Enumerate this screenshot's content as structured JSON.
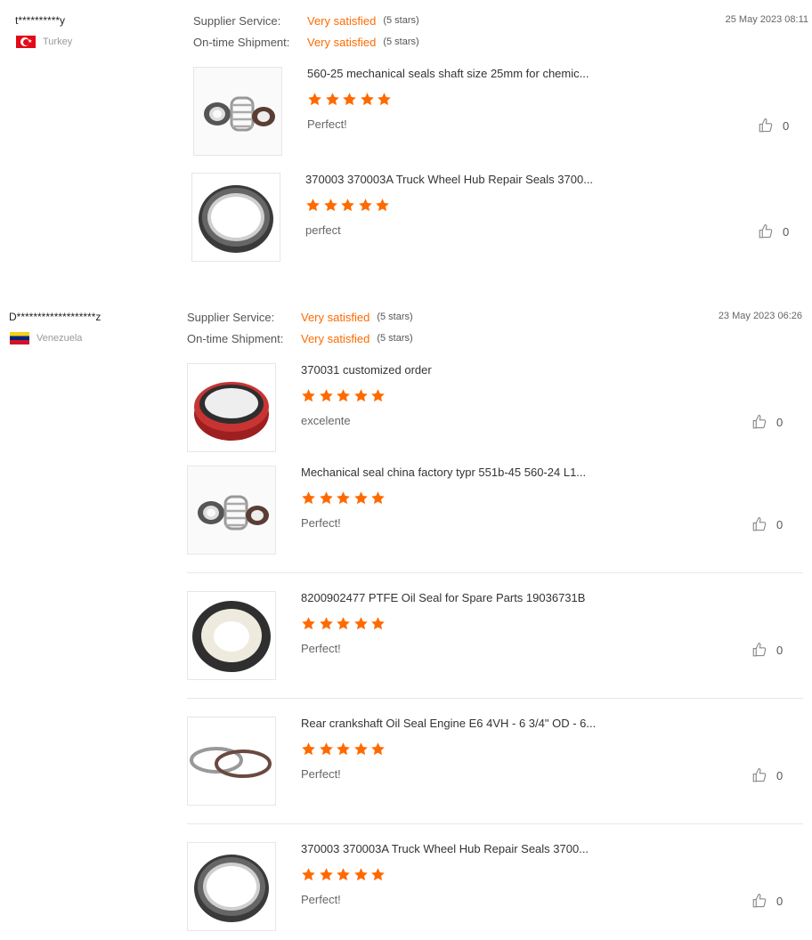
{
  "reviews": [
    {
      "user": "t**********y",
      "country": "Turkey",
      "date": "25 May 2023 08:11",
      "supplier_label": "Supplier Service:",
      "supplier_value": "Very satisfied",
      "supplier_stars": "(5 stars)",
      "shipment_label": "On-time Shipment:",
      "shipment_value": "Very satisfied",
      "shipment_stars": "(5 stars)",
      "items": [
        {
          "title": "560-25 mechanical seals shaft size 25mm for chemic...",
          "rating": 5,
          "comment": "Perfect!",
          "likes": "0",
          "image": "mechanical-seal-parts"
        },
        {
          "title": "370003 370003A Truck Wheel Hub Repair Seals 3700...",
          "rating": 5,
          "comment": "perfect",
          "likes": "0",
          "image": "black-oil-seal-ring"
        }
      ]
    },
    {
      "user": "D*******************z",
      "country": "Venezuela",
      "date": "23 May 2023 06:26",
      "supplier_label": "Supplier Service:",
      "supplier_value": "Very satisfied",
      "supplier_stars": "(5 stars)",
      "shipment_label": "On-time Shipment:",
      "shipment_value": "Very satisfied",
      "shipment_stars": "(5 stars)",
      "items": [
        {
          "title": "370031 customized order",
          "rating": 5,
          "comment": "excelente",
          "likes": "0",
          "image": "red-oil-seal"
        },
        {
          "title": "Mechanical seal china factory typr 551b-45 560-24 L1...",
          "rating": 5,
          "comment": "Perfect!",
          "likes": "0",
          "image": "mechanical-seal-parts"
        },
        {
          "title": "8200902477 PTFE Oil Seal for Spare Parts 19036731B",
          "rating": 5,
          "comment": "Perfect!",
          "likes": "0",
          "image": "ptfe-oil-seal"
        },
        {
          "title": "Rear crankshaft Oil Seal Engine E6 4VH - 6 3/4\" OD - 6...",
          "rating": 5,
          "comment": "Perfect!",
          "likes": "0",
          "image": "thin-seal-rings"
        },
        {
          "title": "370003 370003A Truck Wheel Hub Repair Seals 3700...",
          "rating": 5,
          "comment": "Perfect!",
          "likes": "0",
          "image": "black-oil-seal-ring"
        }
      ]
    }
  ],
  "colors": {
    "accent": "#ff6a00",
    "star": "#ff6a00",
    "divider": "#e8e8e8"
  },
  "icons": {
    "like": "thumbs-up-icon",
    "star": "star-icon"
  }
}
